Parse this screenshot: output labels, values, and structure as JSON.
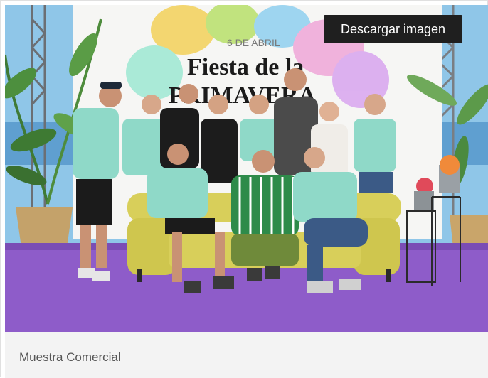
{
  "photo": {
    "banner_date": "6 DE ABRIL",
    "banner_title_line1": "Fiesta de la",
    "banner_title_line2": "PRIMAVERA",
    "alt": "Muestra Comercial"
  },
  "actions": {
    "download_label": "Descargar imagen"
  },
  "caption": {
    "text": "Muestra Comercial"
  },
  "colors": {
    "sky": "#8fc6e8",
    "carpet": "#8e5cc9",
    "tee_green": "#8fd9c8",
    "sofa_yellow": "#d8cf5a",
    "button_bg": "#1f1f1f",
    "caption_bg": "#f3f3f3"
  }
}
